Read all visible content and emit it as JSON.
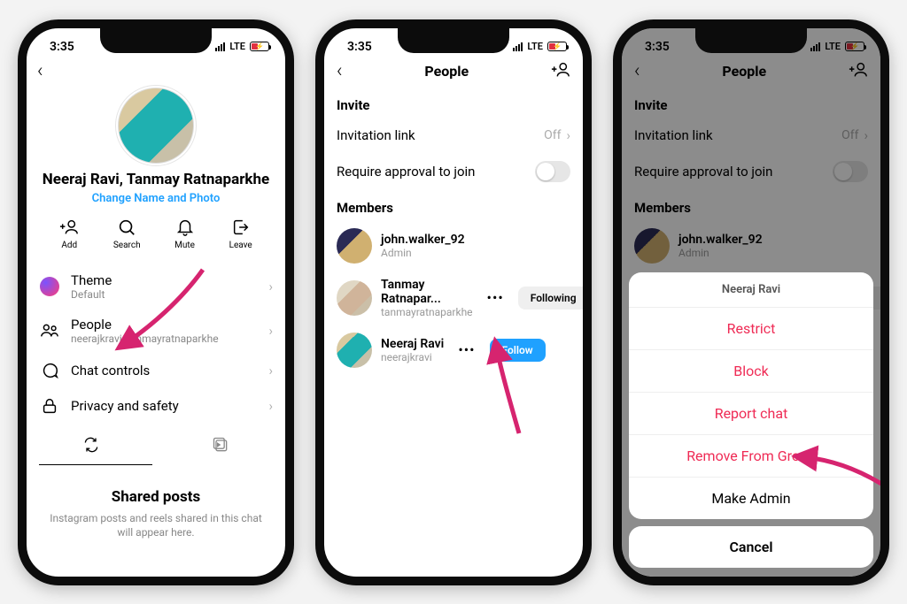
{
  "status": {
    "time": "3:35",
    "net": "LTE"
  },
  "p1": {
    "title": "Neeraj Ravi, Tanmay Ratnaparkhe",
    "change": "Change Name and Photo",
    "actions": {
      "add": "Add",
      "search": "Search",
      "mute": "Mute",
      "leave": "Leave"
    },
    "menu": {
      "theme_t": "Theme",
      "theme_s": "Default",
      "people_t": "People",
      "people_s": "neerajkravi, tanmayratnaparkhe",
      "chat_t": "Chat controls",
      "priv_t": "Privacy and safety"
    },
    "shared_t": "Shared posts",
    "shared_s": "Instagram posts and reels shared in this chat will appear here."
  },
  "p2": {
    "header": "People",
    "invite_h": "Invite",
    "invlink_t": "Invitation link",
    "invlink_v": "Off",
    "approve_t": "Require approval to join",
    "members_h": "Members",
    "m1_n": "john.walker_92",
    "m1_s": "Admin",
    "m2_n": "Tanmay Ratnapar...",
    "m2_s": "tanmayratnaparkhe",
    "m2_b": "Following",
    "m3_n": "Neeraj Ravi",
    "m3_s": "neerajkravi",
    "m3_b": "Follow"
  },
  "p3": {
    "sheet_title": "Neeraj Ravi",
    "restrict": "Restrict",
    "block": "Block",
    "report": "Report chat",
    "remove": "Remove From Group",
    "admin": "Make Admin",
    "cancel": "Cancel"
  }
}
